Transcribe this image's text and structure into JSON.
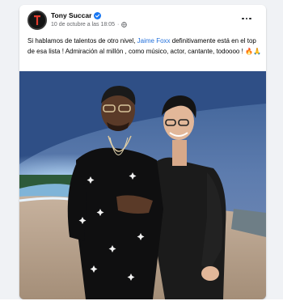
{
  "post": {
    "author": "Tony Succar",
    "timestamp": "10 de octubre a las 18:05",
    "dot": "·",
    "text_before_mention": "Si hablamos de talentos de otro nivel, ",
    "mention": "Jaime Foxx",
    "text_after_mention": " definitivamente está en el top de esa lista ! Admiración al millón , como músico, actor, cantante, todoooo ! 🔥🙏",
    "icons": {
      "avatar": "profile-avatar",
      "verified": "verified-badge-icon",
      "audience": "globe-icon",
      "menu": "more-options-icon"
    }
  },
  "colors": {
    "link": "#216fdb",
    "verified": "#1877f2",
    "secondary_text": "#65676b"
  }
}
